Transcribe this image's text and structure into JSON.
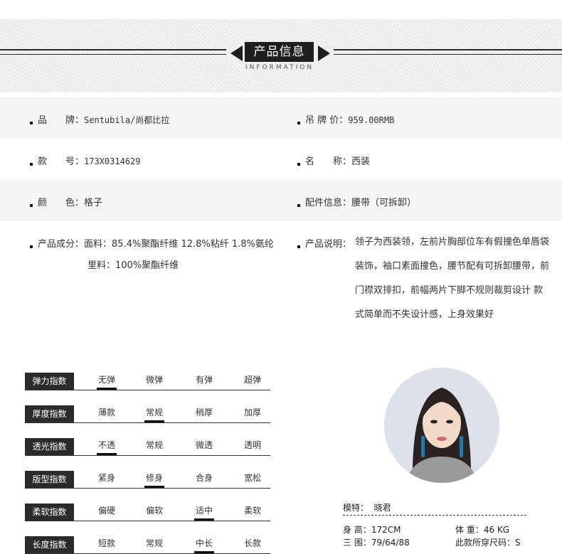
{
  "header": {
    "title": "产品信息",
    "subtitle": "INFORMATION"
  },
  "info": {
    "brand": {
      "label": "品　　牌：",
      "value": "Sentubila/尚都比拉"
    },
    "price": {
      "label": "吊 牌 价：",
      "value": "959.00RMB"
    },
    "style_no": {
      "label": "款　　号：",
      "value": "173X0314629"
    },
    "name": {
      "label": "名　　称：",
      "value": "西装"
    },
    "color": {
      "label": "颜　　色：",
      "value": "格子"
    },
    "accessory": {
      "label": "配件信息：",
      "value": "腰带（可拆卸）"
    },
    "composition": {
      "label": "产品成分：",
      "value": "面料：85.4%聚酯纤维 12.8%粘纤 1.8%氨纶",
      "value2": "里料：100%聚酯纤维"
    },
    "description": {
      "label": "产品说明：",
      "value": "领子为西装领，左前片胸部位车有假撞色单唇袋装饰，袖口素面撞色，腰节配有可拆卸腰带，前门襟双排扣，前幅两片下脚不规则裁剪设计 款式简单而不失设计感，上身效果好"
    }
  },
  "indices": [
    {
      "label": "弹力指数",
      "options": [
        "无弹",
        "微弹",
        "有弹",
        "超弹"
      ],
      "selected": 0
    },
    {
      "label": "厚度指数",
      "options": [
        "薄款",
        "常规",
        "稍厚",
        "加厚"
      ],
      "selected": 1
    },
    {
      "label": "透光指数",
      "options": [
        "不透",
        "常规",
        "微透",
        "透明"
      ],
      "selected": 0
    },
    {
      "label": "版型指数",
      "options": [
        "紧身",
        "修身",
        "合身",
        "宽松"
      ],
      "selected": 1
    },
    {
      "label": "柔软指数",
      "options": [
        "偏硬",
        "偏软",
        "适中",
        "柔软"
      ],
      "selected": 2
    },
    {
      "label": "长度指数",
      "options": [
        "短款",
        "常规",
        "中长",
        "长款"
      ],
      "selected": 2
    }
  ],
  "model": {
    "name_label": "模特：",
    "name": "晓君",
    "height": "身 高：172CM",
    "weight": "体 重：46 KG",
    "measurements": "三 围：79/64/88",
    "size": "此款所穿尺码：S"
  },
  "colors": {
    "dark": "#1e1e1e",
    "banner_bg": "#eeeeee",
    "row_grey": "#f5f5f5"
  }
}
